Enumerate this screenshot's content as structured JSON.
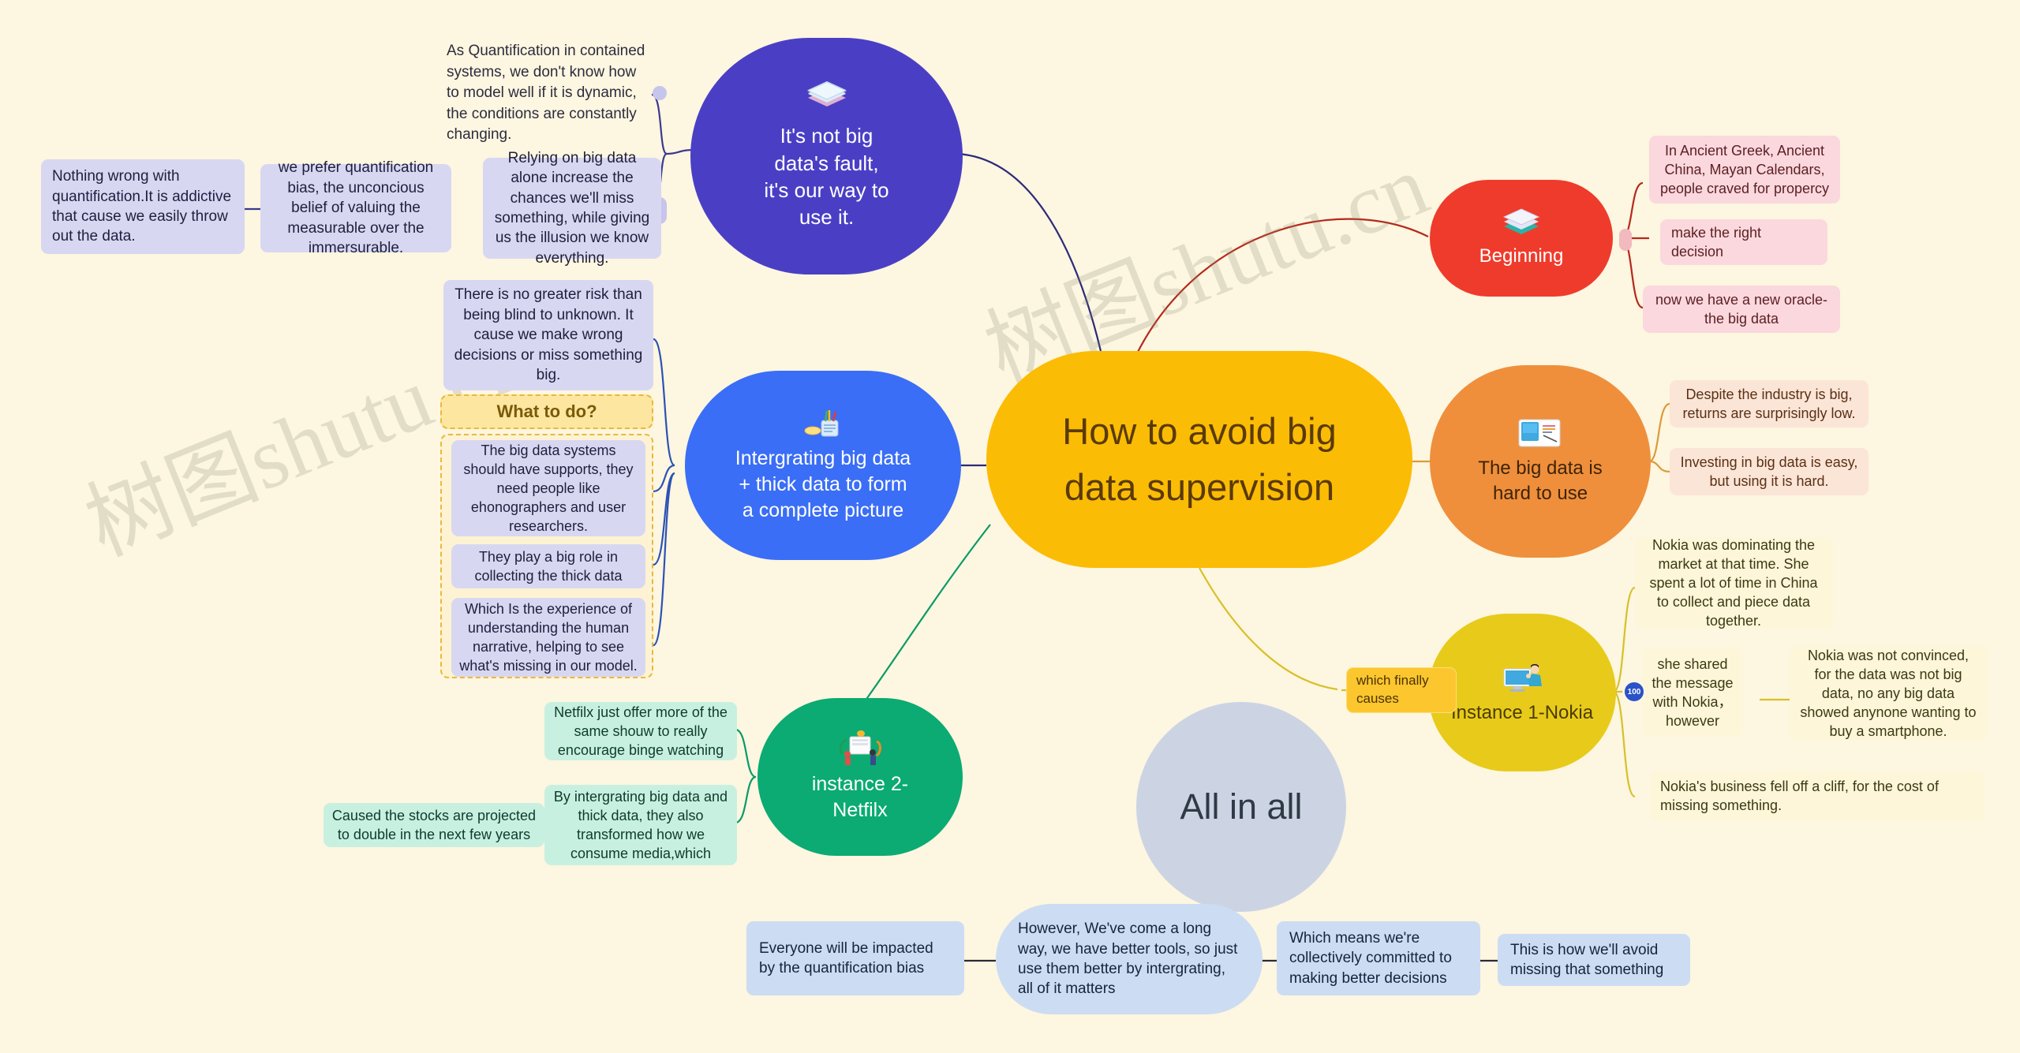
{
  "canvas": {
    "background": "#fdf6e0"
  },
  "watermarks": [
    "树图shutu.cn",
    "树图shutu.cn"
  ],
  "central": {
    "text": "How to avoid big data supervision",
    "color": "#fbbc05",
    "text_color": "#5a3a07"
  },
  "branches": {
    "not_big_data_fault": {
      "label": "It's not big data's fault, it's our way to use it.",
      "color": "#4a3fc4",
      "icon": "books-icon",
      "children": [
        {
          "text": "As Quantification in contained systems, we don't know how to model well if it is dynamic, the conditions are constantly changing.",
          "style": "plain"
        },
        {
          "text": "Relying on big data alone increase the chances we'll miss something, while giving us the illusion we know everything.",
          "style": "purple"
        },
        {
          "text": "we prefer quantification bias, the unconcious belief of valuing the measurable over the immersurable.",
          "style": "purple"
        },
        {
          "text": "Nothing wrong with quantification.It is addictive that cause we  easily throw out the data.",
          "style": "purple"
        }
      ]
    },
    "intergrating": {
      "label": "Intergrating big data + thick data to form a complete picture",
      "color": "#3b6ef6",
      "icon": "pen-holder-icon",
      "children": [
        {
          "text": "There is no greater risk than being blind to unknown. It cause we make wrong decisions or miss something big.",
          "style": "purple"
        }
      ],
      "group": {
        "title": "What to do?",
        "items": [
          {
            "text": "The big data systems should have supports, they need people like ehonographers and user researchers."
          },
          {
            "text": "They play a big role in collecting the thick data"
          },
          {
            "text": "Which Is the experience of understanding the human narrative, helping to see what's missing in our model."
          }
        ]
      }
    },
    "netflix": {
      "label": "instance 2- Netfilx",
      "color": "#0bab73",
      "icon": "presentation-icon",
      "children": [
        {
          "text": "Netfilx just offer more of the same shouw to really encourage binge watching",
          "style": "mint"
        },
        {
          "text": "By intergrating big data and thick data, they also transformed how we consume media,which",
          "style": "mint"
        },
        {
          "text": "Caused the stocks are projected to double in the next few years",
          "style": "mint"
        }
      ]
    },
    "beginning": {
      "label": "Beginning",
      "color": "#ef3b2c",
      "icon": "papers-icon",
      "children": [
        {
          "text": "In Ancient Greek, Ancient China, Mayan Calendars, people craved for propercy",
          "style": "pink"
        },
        {
          "text": "make the right decision",
          "style": "pink"
        },
        {
          "text": "now we have a new oracle-the big data",
          "style": "pink"
        }
      ]
    },
    "hard_to_use": {
      "label": "The big data is hard to use",
      "color": "#ef8f3c",
      "icon": "desk-monitor-icon",
      "children": [
        {
          "text": "Despite the industry is big, returns are surprisingly low.",
          "style": "peach"
        },
        {
          "text": "Investing in big data is easy, but using it is hard.",
          "style": "peach"
        }
      ]
    },
    "nokia": {
      "label": "Instance 1-Nokia",
      "color": "#e8cb1a",
      "icon": "presenter-screen-icon",
      "side_label": "which finally causes",
      "children": [
        {
          "text": "Nokia was dominating the market at that time. She spent a lot of time in China to collect and piece data together.",
          "style": "cream"
        },
        {
          "text": "she shared the message with Nokia， however",
          "style": "cream",
          "badge": "100"
        },
        {
          "text": "Nokia was not convinced, for the data was not big data, no any big data showed anynone wanting to buy a smartphone.",
          "style": "cream"
        },
        {
          "text": "Nokia's business fell off a cliff, for the cost of missing something.",
          "style": "cream"
        }
      ]
    },
    "all_in_all": {
      "label": "All in all",
      "color": "#ccd4e4",
      "text_color": "#2f3a45",
      "children": [
        {
          "text": "However, We've come a long way, we have better tools, so just use them better by intergrating, all of it matters",
          "style": "lblue"
        },
        {
          "text": "Everyone will be impacted by the quantification bias",
          "style": "lblue"
        },
        {
          "text": "Which means we're collectively committed to making better decisions",
          "style": "lblue"
        },
        {
          "text": "This is how we'll avoid missing that something",
          "style": "lblue"
        }
      ]
    }
  }
}
